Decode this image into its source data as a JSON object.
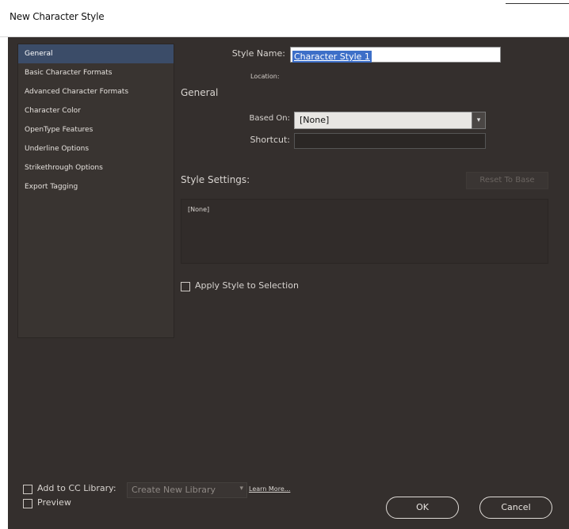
{
  "window": {
    "title": "New Character Style"
  },
  "sidebar": {
    "items": [
      {
        "label": "General",
        "selected": true
      },
      {
        "label": "Basic Character Formats",
        "selected": false
      },
      {
        "label": "Advanced Character Formats",
        "selected": false
      },
      {
        "label": "Character Color",
        "selected": false
      },
      {
        "label": "OpenType Features",
        "selected": false
      },
      {
        "label": "Underline Options",
        "selected": false
      },
      {
        "label": "Strikethrough Options",
        "selected": false
      },
      {
        "label": "Export Tagging",
        "selected": false
      }
    ]
  },
  "form": {
    "style_name_label": "Style Name:",
    "style_name_value": "Character Style 1",
    "location_label": "Location:",
    "section_title": "General",
    "based_on_label": "Based On:",
    "based_on_value": "[None]",
    "shortcut_label": "Shortcut:",
    "shortcut_value": "",
    "style_settings_label": "Style Settings:",
    "reset_button": "Reset To Base",
    "style_settings_text": "[None]",
    "apply_style_label": "Apply Style to Selection",
    "apply_style_checked": false
  },
  "footer": {
    "cc_library_label": "Add to CC Library:",
    "cc_library_checked": false,
    "library_select_value": "Create New Library",
    "learn_more": "Learn More...",
    "preview_label": "Preview",
    "preview_checked": false,
    "ok_label": "OK",
    "cancel_label": "Cancel"
  },
  "colors": {
    "dialog_bg": "#342f2d",
    "selection": "#3b4c68",
    "highlight": "#3d6fc8"
  }
}
